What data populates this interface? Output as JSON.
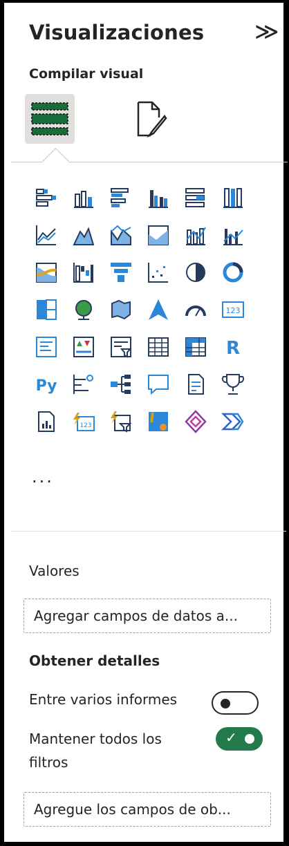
{
  "panel": {
    "title": "Visualizaciones",
    "collapse_icon": "double-chevron-right-icon",
    "collapse_glyph": "≫",
    "build_visual_label": "Compilar visual",
    "modes": [
      {
        "name": "build-visual-icon",
        "active": true
      },
      {
        "name": "format-visual-icon",
        "active": false
      }
    ],
    "visual_icons": [
      "stacked-bar-chart-icon",
      "stacked-column-chart-icon",
      "clustered-bar-chart-icon",
      "clustered-column-chart-icon",
      "100-stacked-bar-chart-icon",
      "100-stacked-column-chart-icon",
      "line-chart-icon",
      "area-chart-icon",
      "stacked-area-chart-icon",
      "100-stacked-area-chart-icon",
      "line-stacked-column-chart-icon",
      "line-clustered-column-chart-icon",
      "ribbon-chart-icon",
      "waterfall-chart-icon",
      "funnel-chart-icon",
      "scatter-chart-icon",
      "pie-chart-icon",
      "donut-chart-icon",
      "treemap-icon",
      "map-icon",
      "filled-map-icon",
      "azure-map-icon",
      "gauge-icon",
      "card-icon",
      "multi-row-card-icon",
      "kpi-icon",
      "slicer-icon",
      "table-icon",
      "matrix-icon",
      "r-script-visual-icon",
      "python-visual-icon",
      "key-influencers-icon",
      "decomposition-tree-icon",
      "qa-icon",
      "smart-narrative-icon",
      "metrics-icon",
      "paginated-report-icon",
      "power-apps-card-icon",
      "power-apps-slicer-icon",
      "arcgis-map-icon",
      "power-apps-icon",
      "power-automate-icon"
    ],
    "more_label": "...",
    "values_label": "Valores",
    "values_placeholder": "Agregar campos de datos a...",
    "drillthrough_label": "Obtener detalles",
    "cross_report_label": "Entre varios informes",
    "cross_report_value": "Desactivado",
    "keep_filters_label": "Mantener todos los filtros",
    "keep_filters_value": "Activado",
    "drillthrough_placeholder": "Agregue los campos de ob..."
  },
  "colors": {
    "text": "#252423",
    "bi_blue": "#2b88d8",
    "bi_dark": "#243a5e",
    "toggle_on": "#237b4b",
    "active_bg": "#e1dfdd"
  }
}
